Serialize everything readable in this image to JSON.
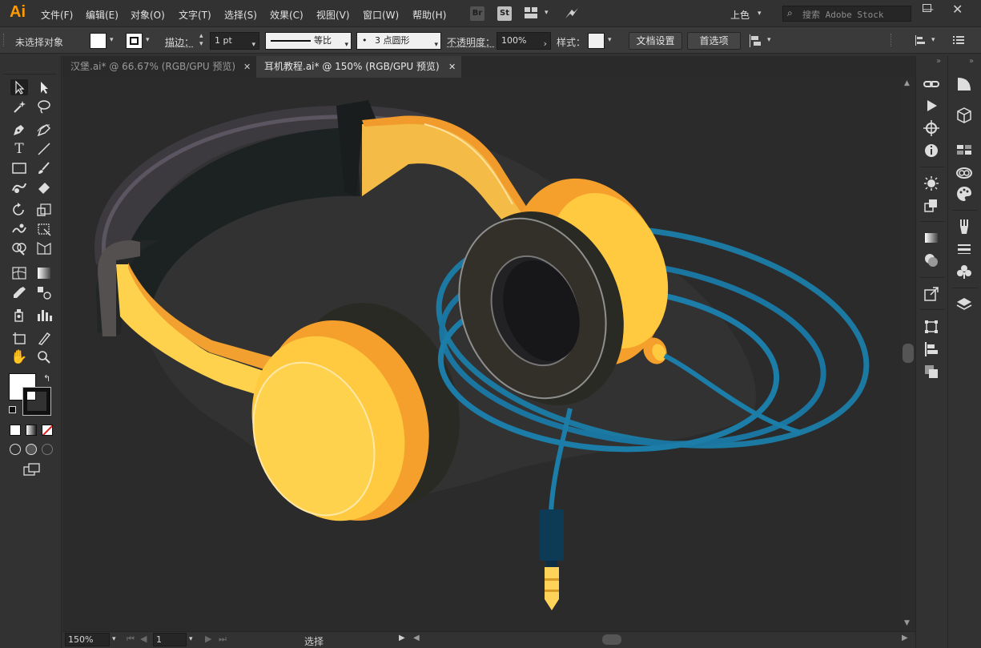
{
  "app": {
    "logo": "Ai",
    "accent": "#FF9A00"
  },
  "menu": {
    "items": [
      "文件(F)",
      "编辑(E)",
      "对象(O)",
      "文字(T)",
      "选择(S)",
      "效果(C)",
      "视图(V)",
      "窗口(W)",
      "帮助(H)"
    ],
    "bridge": "Br",
    "stock_app": "St",
    "workspace": "上色",
    "search_placeholder": "搜索 Adobe Stock"
  },
  "control_bar": {
    "selection_status": "未选择对象",
    "stroke_label": "描边：",
    "stroke_weight": "1 pt",
    "stroke_profile": "等比",
    "brush": "3 点圆形",
    "brush_prefix": "•",
    "opacity_label": "不透明度：",
    "opacity_value": "100%",
    "style_label": "样式：",
    "doc_setup_button": "文档设置",
    "preferences_button": "首选项",
    "fill_color": "#FFFFFF"
  },
  "tabs": [
    {
      "label": "汉堡.ai* @ 66.67% (RGB/GPU 预览)",
      "active": false
    },
    {
      "label": "耳机教程.ai* @ 150% (RGB/GPU 预览)",
      "active": true
    }
  ],
  "status_bar": {
    "zoom": "150%",
    "page": "1",
    "tool_status": "选择"
  },
  "artwork": {
    "background": "#2B2B2B",
    "headphone_yellow": "#FFC940",
    "headphone_orange": "#F5A02C",
    "cushion_dark": "#2A2A24",
    "cable_blue": "#1B7DA8",
    "plug_gold": "#FFD35A"
  },
  "tool_icons": [
    "selection-tool",
    "direct-selection-tool",
    "magic-wand-tool",
    "lasso-tool",
    "pen-tool",
    "curvature-tool",
    "type-tool",
    "line-tool",
    "rectangle-tool",
    "paintbrush-tool",
    "shaper-tool",
    "eraser-tool",
    "rotate-tool",
    "scale-tool",
    "warp-tool",
    "free-transform-tool",
    "shape-builder-tool",
    "perspective-grid-tool",
    "mesh-tool",
    "gradient-tool",
    "eyedropper-tool",
    "blend-tool",
    "symbol-sprayer-tool",
    "column-graph-tool",
    "artboard-tool",
    "slice-tool",
    "hand-tool",
    "zoom-tool"
  ]
}
